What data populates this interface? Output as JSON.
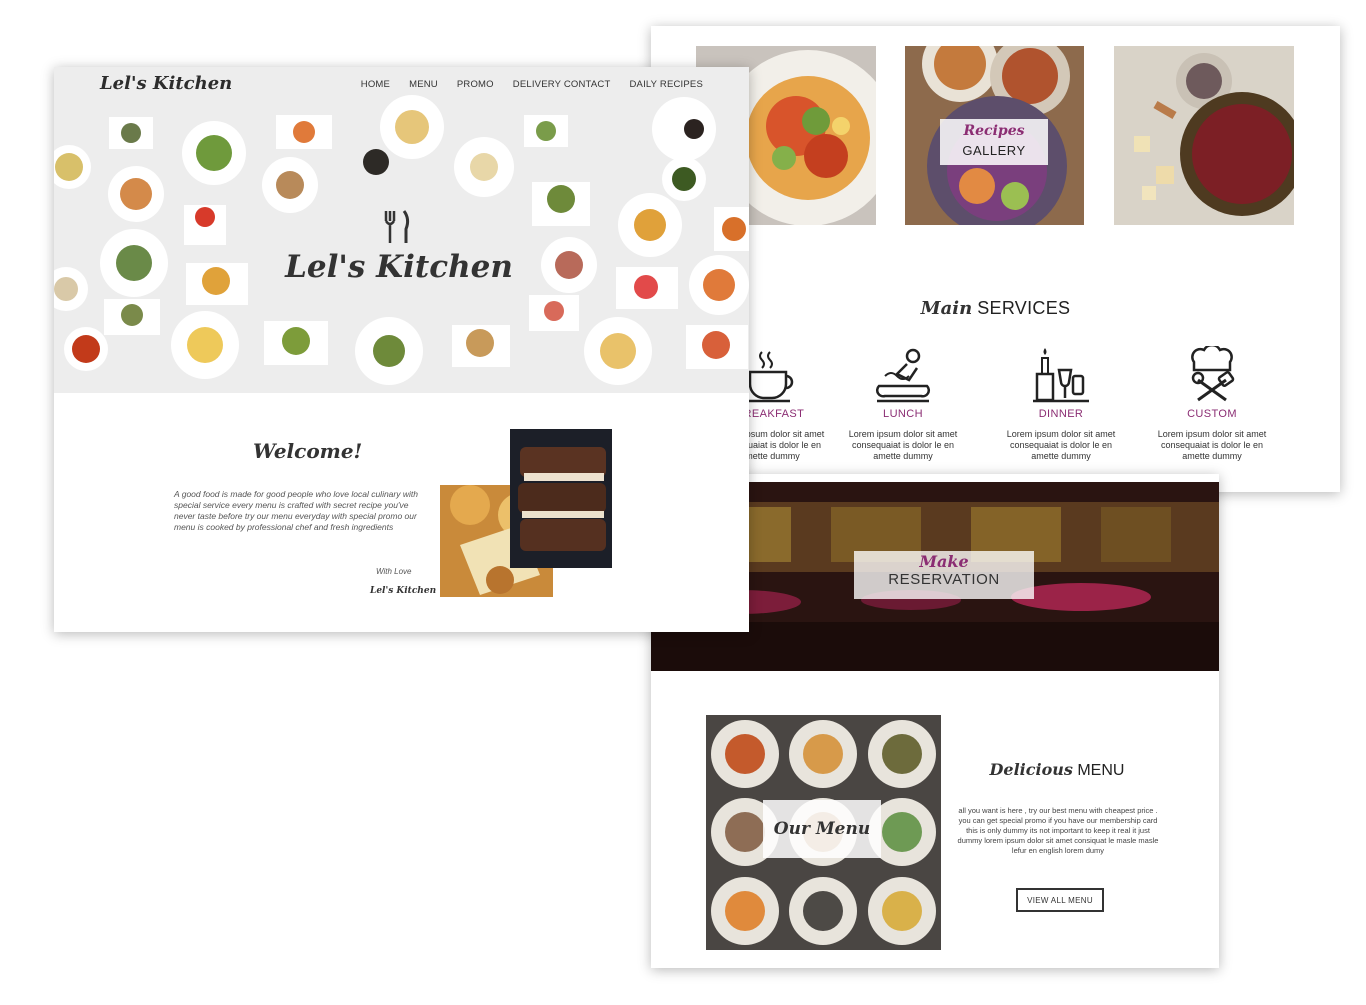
{
  "home": {
    "logo": "Lel's Kitchen",
    "nav": [
      "HOME",
      "MENU",
      "PROMO",
      "DELIVERY CONTACT",
      "DAILY RECIPES"
    ],
    "hero_title": "Lel's Kitchen",
    "welcome": {
      "title": "Welcome!",
      "text": "A good food is made for good people who love local culinary with special service every menu is crafted with secret recipe you've never taste before try our menu everyday with special promo our menu is cooked by professional chef and fresh ingredients",
      "with_love": "With Love",
      "signature": "Lel's Kitchen"
    }
  },
  "gallery": {
    "label_script": "Recipes",
    "label_main": "GALLERY"
  },
  "services": {
    "title_script": "Main",
    "title_main": "SERVICES",
    "items": [
      {
        "icon": "coffee-cup-icon",
        "name": "BREAKFAST",
        "desc": "Lorem ipsum dolor sit amet consequaiat is dolor le en amette dummy"
      },
      {
        "icon": "chef-cooking-icon",
        "name": "LUNCH",
        "desc": "Lorem ipsum dolor sit amet consequaiat is dolor le en amette dummy"
      },
      {
        "icon": "candle-dinner-icon",
        "name": "DINNER",
        "desc": "Lorem ipsum dolor sit amet consequaiat is dolor le en amette dummy"
      },
      {
        "icon": "chef-hat-icon",
        "name": "CUSTOM",
        "desc": "Lorem ipsum dolor sit amet consequaiat is dolor le en amette dummy"
      }
    ]
  },
  "reservation": {
    "label_script": "Make",
    "label_main": "RESERVATION"
  },
  "menu": {
    "grid_label": "Our Menu",
    "title_script": "Delicious",
    "title_main": "MENU",
    "desc": "all you want is here , try our best menu with cheapest price . you can get special promo if you have our membership card this is only dummy its not important to keep it real it just dummy lorem ipsum dolor sit amet consiquat le masle masle lefur en english lorem dumy",
    "button": "VIEW ALL MENU"
  },
  "colors": {
    "accent": "#8b2d73",
    "text": "#333333",
    "hero_bg": "#ededed"
  }
}
